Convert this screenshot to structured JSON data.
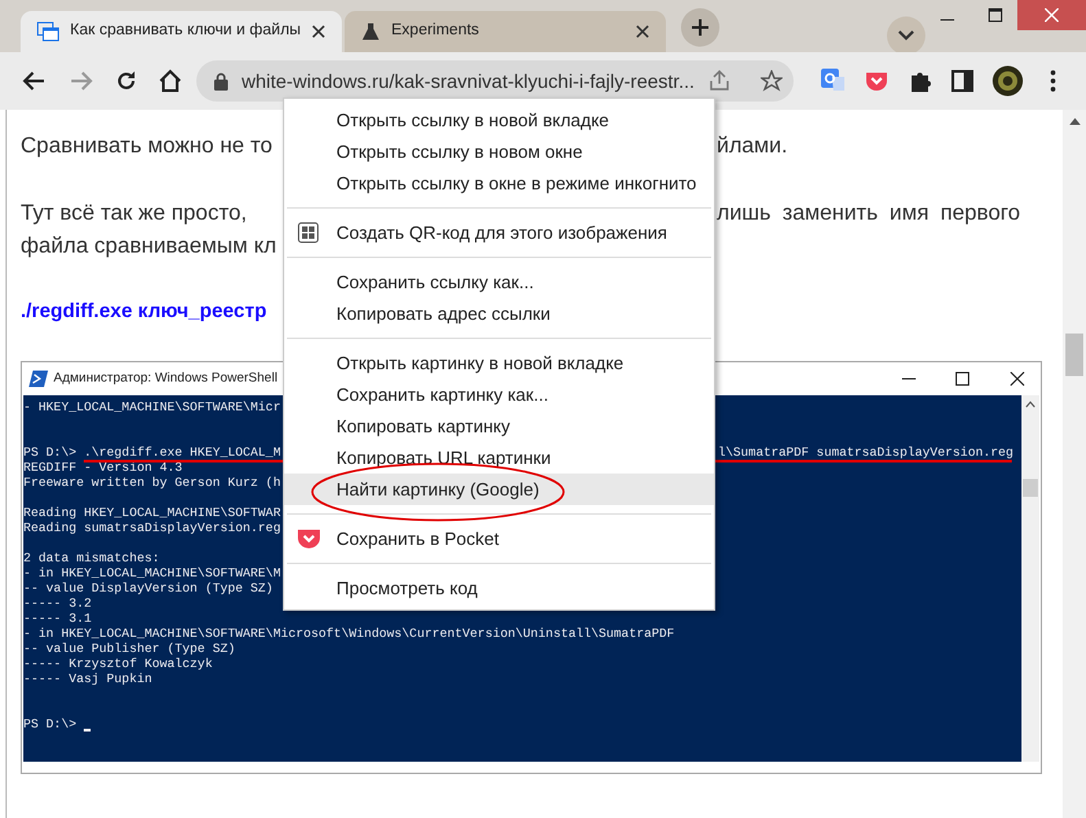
{
  "tabs": [
    {
      "title": "Как сравнивать ключи и файлы",
      "kind": "page",
      "selected": true
    },
    {
      "title": "Experiments",
      "kind": "flask",
      "selected": false
    }
  ],
  "toolbar": {
    "back_disabled": false,
    "forward_disabled": true,
    "url": "white-windows.ru/kak-sravnivat-klyuchi-i-fajly-reestr..."
  },
  "article": {
    "paragraphs": [
      {
        "lines": [
          {
            "left": "Сравнивать можно не то",
            "right": "йлами."
          }
        ]
      },
      {
        "lines": [
          {
            "left": "Тут всё так же просто,",
            "right": "лишь заменить имя первого"
          },
          {
            "left": "файла сравниваемым кл"
          }
        ]
      }
    ],
    "link": "./regdiff.exe ключ_реестр"
  },
  "powershell": {
    "title": "Администратор: Windows PowerShell",
    "lines": [
      {
        "kind": "text",
        "left": "- HKEY_LOCAL_MACHINE\\SOFTWARE\\Micr"
      },
      {
        "kind": "blank"
      },
      {
        "kind": "blank"
      },
      {
        "kind": "text",
        "left": "PS D:\\> .\\regdiff.exe HKEY_LOCAL_M",
        "right": "l\\SumatraPDF sumatrsaDisplayVersion.reg"
      },
      {
        "kind": "text",
        "left": "REGDIFF - Version 4.3"
      },
      {
        "kind": "text",
        "left": "Freeware written by Gerson Kurz (h"
      },
      {
        "kind": "blank"
      },
      {
        "kind": "text",
        "left": "Reading HKEY_LOCAL_MACHINE\\SOFTWAR"
      },
      {
        "kind": "text",
        "left": "Reading sumatrsaDisplayVersion.reg"
      },
      {
        "kind": "blank"
      },
      {
        "kind": "text",
        "left": "2 data mismatches:"
      },
      {
        "kind": "text",
        "left": "- in HKEY_LOCAL_MACHINE\\SOFTWARE\\M"
      },
      {
        "kind": "text",
        "left": "-- value DisplayVersion (Type SZ)"
      },
      {
        "kind": "text",
        "left": "----- 3.2"
      },
      {
        "kind": "text",
        "left": "----- 3.1"
      },
      {
        "kind": "text",
        "left": "- in HKEY_LOCAL_MACHINE\\SOFTWARE\\Microsoft\\Windows\\CurrentVersion\\Uninstall\\SumatraPDF"
      },
      {
        "kind": "text",
        "left": "-- value Publisher (Type SZ)"
      },
      {
        "kind": "text",
        "left": "----- Krzysztof Kowalczyk"
      },
      {
        "kind": "text",
        "left": "----- Vasj Pupkin"
      },
      {
        "kind": "blank"
      },
      {
        "kind": "blank"
      },
      {
        "kind": "text",
        "left": "PS D:\\> ",
        "cursor": true
      }
    ]
  },
  "context_menu": {
    "groups": [
      [
        {
          "label": "Открыть ссылку в новой вкладке",
          "kind": "plain",
          "selected": false
        },
        {
          "label": "Открыть ссылку в новом окне",
          "kind": "plain",
          "selected": false
        },
        {
          "label": "Открыть ссылку в окне в режиме инкогнито",
          "kind": "plain",
          "selected": false
        }
      ],
      [
        {
          "label": "Создать QR-код для этого изображения",
          "kind": "qr",
          "selected": false
        }
      ],
      [
        {
          "label": "Сохранить ссылку как...",
          "kind": "plain",
          "selected": false
        },
        {
          "label": "Копировать адрес ссылки",
          "kind": "plain",
          "selected": false
        }
      ],
      [
        {
          "label": "Открыть картинку в новой вкладке",
          "kind": "plain",
          "selected": false
        },
        {
          "label": "Сохранить картинку как...",
          "kind": "plain",
          "selected": false
        },
        {
          "label": "Копировать картинку",
          "kind": "plain",
          "selected": false
        },
        {
          "label": "Копировать URL картинки",
          "kind": "plain",
          "selected": false
        },
        {
          "label": "Найти картинку (Google)",
          "kind": "plain",
          "selected": true
        }
      ],
      [
        {
          "label": "Сохранить в Pocket",
          "kind": "pocket",
          "selected": false
        }
      ],
      [
        {
          "label": "Просмотреть код",
          "kind": "plain",
          "selected": false
        }
      ]
    ]
  }
}
